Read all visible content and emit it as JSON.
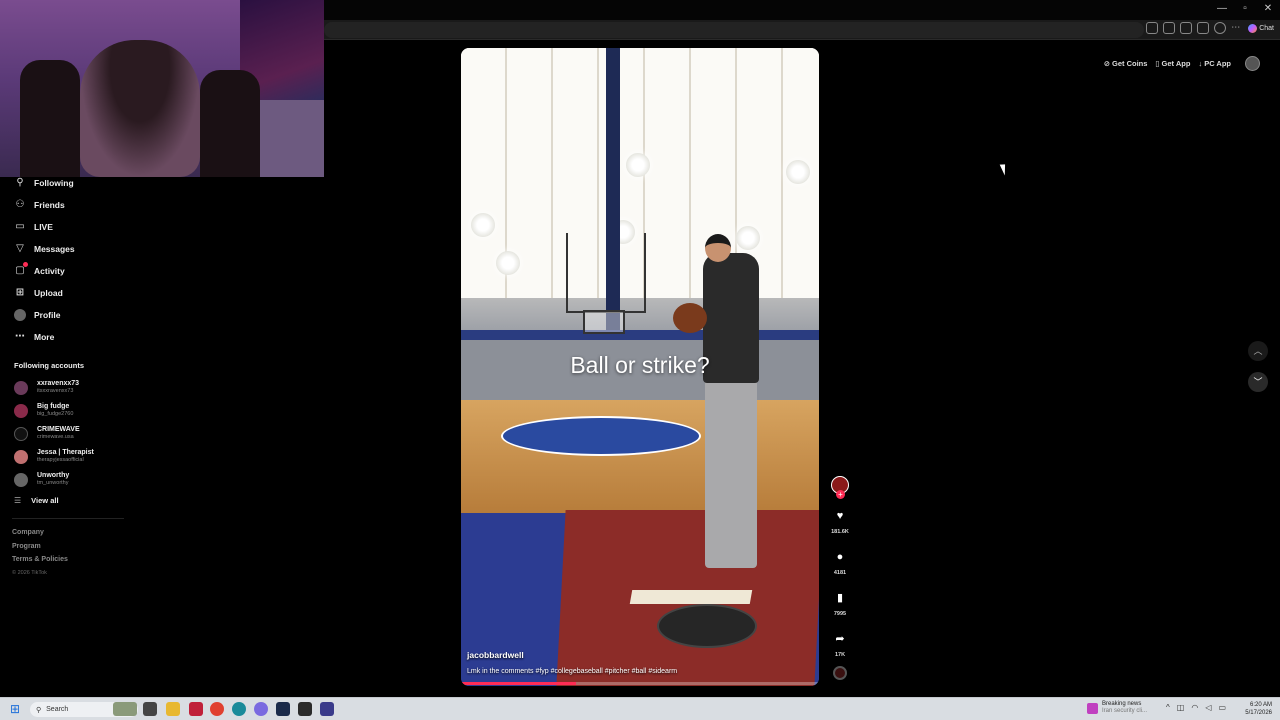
{
  "topbar": {
    "get_coins": "Get Coins",
    "get_app": "Get App",
    "pc_app": "PC App"
  },
  "browser": {
    "chat_label": "Chat"
  },
  "nav": {
    "items": [
      {
        "label": "Following",
        "icon": "following-icon"
      },
      {
        "label": "Friends",
        "icon": "friends-icon"
      },
      {
        "label": "LIVE",
        "icon": "live-icon"
      },
      {
        "label": "Messages",
        "icon": "messages-icon"
      },
      {
        "label": "Activity",
        "icon": "activity-icon"
      },
      {
        "label": "Upload",
        "icon": "upload-icon"
      },
      {
        "label": "Profile",
        "icon": "profile-icon"
      },
      {
        "label": "More",
        "icon": "more-icon"
      }
    ]
  },
  "following_accounts": {
    "title": "Following accounts",
    "accounts": [
      {
        "name": "xxravenxx73",
        "handle": "itsxxravenxx73",
        "color": "#6a3a5a"
      },
      {
        "name": "Big fudge",
        "handle": "big_fudge2760",
        "color": "#8a2a4a"
      },
      {
        "name": "CRIMEWAVE",
        "handle": "crimewave.usa",
        "color": "#111111"
      },
      {
        "name": "Jessa | Therapist",
        "handle": "therapyjessaofficial",
        "color": "#c07070"
      },
      {
        "name": "Unworthy",
        "handle": "tm_unworthy",
        "color": "#666666"
      }
    ],
    "view_all": "View all"
  },
  "footer": {
    "company": "Company",
    "program": "Program",
    "terms": "Terms & Policies",
    "copyright": "© 2026 TikTok"
  },
  "video": {
    "caption": "Ball or strike?",
    "username": "jacobbardwell",
    "description": "Lmk in the comments #fyp #collegebaseball #pitcher #ball #sidearm",
    "progress": 0.32
  },
  "actions": {
    "likes": "181.6K",
    "comments": "4181",
    "saves": "7995",
    "shares": "17K"
  },
  "taskbar": {
    "search_placeholder": "Search",
    "news_title": "Breaking news",
    "news_sub": "Iran security cli...",
    "time": "6:20 AM",
    "date": "5/17/2026"
  },
  "colors": {
    "accent": "#fe2c55",
    "background": "#000000"
  }
}
